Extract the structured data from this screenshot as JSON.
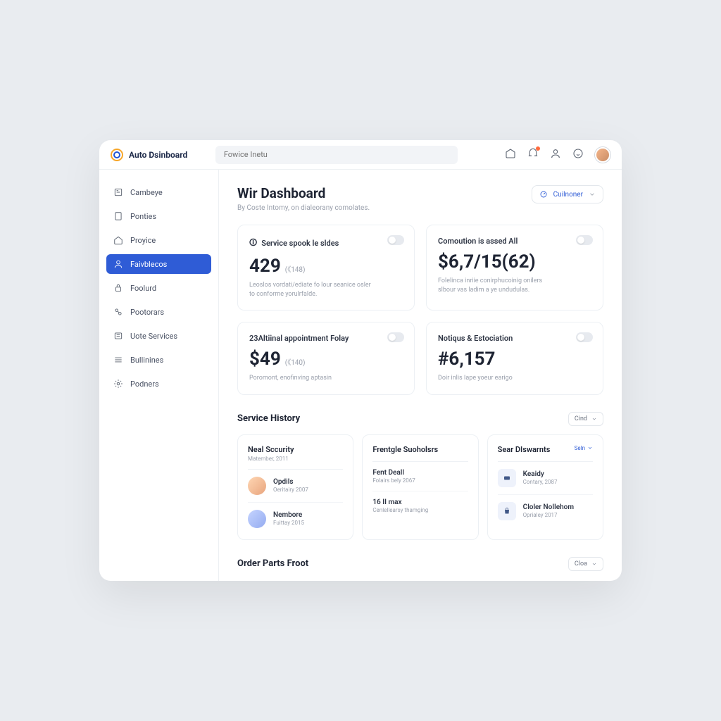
{
  "brand": {
    "title": "Auto Dsinboard"
  },
  "search": {
    "placeholder": "Fowice Inetu"
  },
  "sidebar": {
    "items": [
      {
        "label": "Cambeye"
      },
      {
        "label": "Ponties"
      },
      {
        "label": "Proyice"
      },
      {
        "label": "Faivblecos"
      },
      {
        "label": "Foolurd"
      },
      {
        "label": "Pootorars"
      },
      {
        "label": "Uote Services"
      },
      {
        "label": "Bullinines"
      },
      {
        "label": "Podners"
      }
    ]
  },
  "page": {
    "title": "Wir Dashboard",
    "subtitle": "By Coste Intomy, on dialeorany comolates.",
    "filter_label": "Cuilnoner"
  },
  "cards": [
    {
      "eyebrow": "Service spook le sldes",
      "value": "429",
      "sub": "(《148)",
      "desc": "Leoslos vordati/ediate fo lour seanice osler to conforme yorulrfalde."
    },
    {
      "eyebrow": "Comoution is assed All",
      "value": "$6,7/15(62)",
      "sub": "",
      "desc": "Folelinca inriie conirphucoinig onilers slbour vas ladim a ye undudulas."
    },
    {
      "eyebrow": "23Altiinal appointment Folay",
      "value": "$49",
      "sub": "(《140)",
      "desc": "Poromont, enofinving aptasin"
    },
    {
      "eyebrow": "Notiqus & Estociation",
      "value": "#6,157",
      "sub": "",
      "desc": "Doir inlis Iape yoeur earigo"
    }
  ],
  "history": {
    "title": "Service History",
    "chip": "Cind",
    "panels": [
      {
        "title": "Neal Sccurity",
        "sub": "Matember, 2011",
        "rows": [
          {
            "t": "Opdils",
            "s": "Oeritairy 2007",
            "avatar": true,
            "alt": false
          },
          {
            "t": "Nembore",
            "s": "Fuittay 2015",
            "avatar": true,
            "alt": true
          }
        ]
      },
      {
        "title": "Frentgle Suoholsrs",
        "sub": "",
        "rows": [
          {
            "t": "Fent Deall",
            "s": "Folairs bely 2067",
            "avatar": false
          },
          {
            "t": "16 II max",
            "s": "Cenlellearsy thamging",
            "avatar": false
          }
        ]
      },
      {
        "title": "Sear DIswarnts",
        "sub": "",
        "pill": "Seln",
        "rows": [
          {
            "t": "Keaidy",
            "s": "Contary, 2087",
            "icon": true
          },
          {
            "t": "Cloler NoIlehom",
            "s": "Oprialey 2017",
            "icon": true
          }
        ]
      }
    ]
  },
  "footer": {
    "title": "Order Parts Froot",
    "chip": "Cloa"
  }
}
